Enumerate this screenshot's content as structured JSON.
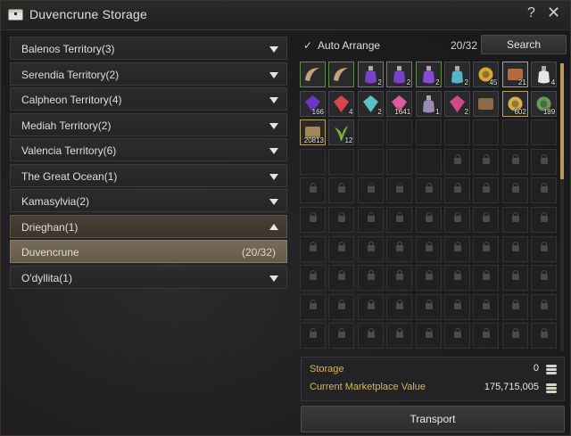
{
  "window": {
    "title": "Duvencrune Storage",
    "help_label": "?",
    "close_label": "✕"
  },
  "regions": [
    {
      "label": "Balenos Territory(3)",
      "state": "collapsed"
    },
    {
      "label": "Serendia Territory(2)",
      "state": "collapsed"
    },
    {
      "label": "Calpheon Territory(4)",
      "state": "collapsed"
    },
    {
      "label": "Mediah Territory(2)",
      "state": "collapsed"
    },
    {
      "label": "Valencia Territory(6)",
      "state": "collapsed"
    },
    {
      "label": "The Great Ocean(1)",
      "state": "collapsed"
    },
    {
      "label": "Kamasylvia(2)",
      "state": "collapsed"
    },
    {
      "label": "Drieghan(1)",
      "state": "expanded"
    },
    {
      "label": "Duvencrune",
      "count": "(20/32)",
      "state": "selected"
    },
    {
      "label": "O'dyllita(1)",
      "state": "collapsed"
    }
  ],
  "toolbar": {
    "check": "✓",
    "auto_arrange_label": "Auto Arrange",
    "slot_count": "20/32",
    "search_label": "Search"
  },
  "inventory": {
    "filled_items": [
      {
        "icon": "horn-icon",
        "qty": "",
        "color": "#c9a27c",
        "frame": "green"
      },
      {
        "icon": "horn-icon",
        "qty": "",
        "color": "#c9a27c",
        "frame": "green"
      },
      {
        "icon": "purple-potion-icon",
        "qty": "2",
        "color": "#7d3fc9",
        "frame": "green"
      },
      {
        "icon": "purple-potion-icon",
        "qty": "2",
        "color": "#7d3fc9",
        "frame": "green"
      },
      {
        "icon": "purple-potion-icon",
        "qty": "2",
        "color": "#8a4ad6",
        "frame": "green"
      },
      {
        "icon": "flask-icon",
        "qty": "2",
        "color": "#55b5c4",
        "frame": ""
      },
      {
        "icon": "gold-orb-icon",
        "qty": "45",
        "color": "#d9a62e",
        "frame": ""
      },
      {
        "icon": "scroll-icon",
        "qty": "21",
        "color": "#b86a3a",
        "frame": "gold"
      },
      {
        "icon": "milk-bottle-icon",
        "qty": "4",
        "color": "#e6e6e6",
        "frame": ""
      },
      {
        "icon": "purple-crystal-icon",
        "qty": "166",
        "color": "#6d35c0",
        "frame": ""
      },
      {
        "icon": "red-gem-icon",
        "qty": "4",
        "color": "#d6454b",
        "frame": ""
      },
      {
        "icon": "cyan-shard-icon",
        "qty": "2",
        "color": "#58c2c8",
        "frame": ""
      },
      {
        "icon": "pink-shard-icon",
        "qty": "1641",
        "color": "#e05a9e",
        "frame": ""
      },
      {
        "icon": "bottle-icon",
        "qty": "1",
        "color": "#9a8ab8",
        "frame": ""
      },
      {
        "icon": "pink-gem-icon",
        "qty": "2",
        "color": "#d04a8a",
        "frame": ""
      },
      {
        "icon": "chest-icon",
        "qty": "",
        "color": "#8a6a4a",
        "frame": ""
      },
      {
        "icon": "gold-ring-icon",
        "qty": "602",
        "color": "#d8b04a",
        "frame": "gold"
      },
      {
        "icon": "green-coin-icon",
        "qty": "189",
        "color": "#6a9a5a",
        "frame": ""
      },
      {
        "icon": "map-icon",
        "qty": "20813",
        "color": "#a0895a",
        "frame": "gold"
      },
      {
        "icon": "herb-icon",
        "qty": "12",
        "color": "#7fb043",
        "frame": ""
      }
    ],
    "empty_unlocked": 12,
    "locked": 58
  },
  "info": {
    "storage_label": "Storage",
    "storage_value": "0",
    "market_label": "Current Marketplace Value",
    "market_value": "175,715,005"
  },
  "transport_label": "Transport"
}
